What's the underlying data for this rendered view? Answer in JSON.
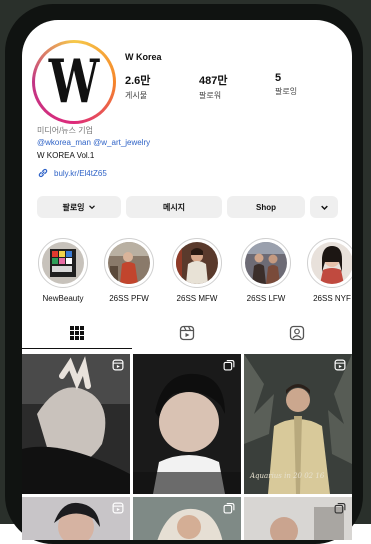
{
  "profile": {
    "username": "W Korea",
    "avatar_letter": "W",
    "stats": [
      {
        "value": "2.6만",
        "label": "게시물"
      },
      {
        "value": "487만",
        "label": "팔로워"
      },
      {
        "value": "5",
        "label": "팔로잉"
      }
    ],
    "category": "미디어/뉴스 기업",
    "tags": "@wkorea_man @w_art_jewelry",
    "bio_line": "W KOREA Vol.1",
    "link": "buly.kr/El4tZ65"
  },
  "actions": {
    "follow": "팔로잉",
    "message": "메시지",
    "shop": "Shop"
  },
  "highlights": [
    {
      "label": "NewBeauty"
    },
    {
      "label": "26SS PFW"
    },
    {
      "label": "26SS MFW"
    },
    {
      "label": "26SS LFW"
    },
    {
      "label": "26SS NYF"
    }
  ],
  "tabs": [
    "grid-icon",
    "reels-icon",
    "tagged-icon"
  ],
  "posts": [
    {
      "caption": ""
    },
    {
      "caption": ""
    },
    {
      "caption": "Aquarius in 20 02 16"
    }
  ],
  "colors": {
    "link": "#2f63c7",
    "button_bg": "#efefef",
    "phone_frame": "#101311"
  }
}
